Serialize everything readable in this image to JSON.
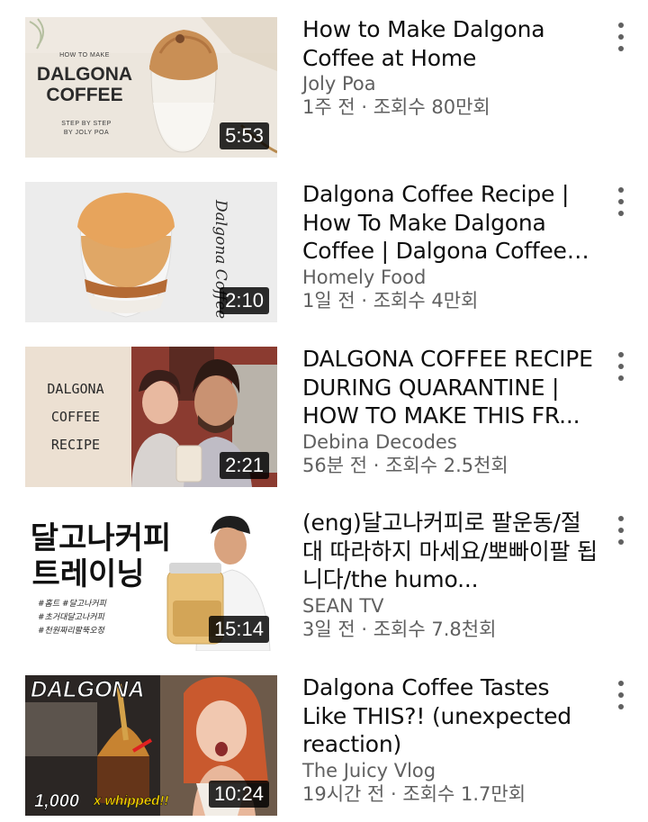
{
  "videos": [
    {
      "title": "How to Make Dalgona Coffee at Home",
      "channel": "Joly Poa",
      "age": "1주 전",
      "sep": " · ",
      "views": "조회수 80만회",
      "duration": "5:53",
      "thumb_text": [
        "HOW TO MAKE",
        "DALGONA",
        "COFFEE",
        "STEP BY STEP",
        "BY JOLY POA"
      ]
    },
    {
      "title": "Dalgona Coffee Recipe | How To Make Dalgona Coffee | Dalgona Coffee R...",
      "channel": "Homely Food",
      "age": "1일 전",
      "sep": " · ",
      "views": "조회수 4만회",
      "duration": "2:10",
      "thumb_text": [
        "Dalgona Coffee"
      ]
    },
    {
      "title": "DALGONA COFFEE RECIPE DURING QUARANTINE | HOW TO MAKE THIS FR...",
      "channel": "Debina Decodes",
      "age": "56분 전",
      "sep": " · ",
      "views": "조회수 2.5천회",
      "duration": "2:21",
      "thumb_text": [
        "DALGONA",
        "COFFEE",
        "RECIPE"
      ]
    },
    {
      "title": "(eng)달고나커피로 팔운동/절대 따라하지 마세요/뽀빠이팔 됩니다/the humo...",
      "channel": "SEAN TV",
      "age": "3일 전",
      "sep": " · ",
      "views": "조회수 7.8천회",
      "duration": "15:14",
      "thumb_text": [
        "달고나커피",
        "트레이닝",
        "#홈트 #달고나커피",
        "#초거대달고나커피",
        "#천원짜리팔뚝오정"
      ]
    },
    {
      "title": "Dalgona Coffee Tastes Like THIS?! (unexpected reaction)",
      "channel": "The Juicy Vlog",
      "age": "19시간 전",
      "sep": " · ",
      "views": "조회수 1.7만회",
      "duration": "10:24",
      "thumb_text": [
        "DALGONA",
        "1,000",
        "x whipped!!"
      ]
    }
  ]
}
